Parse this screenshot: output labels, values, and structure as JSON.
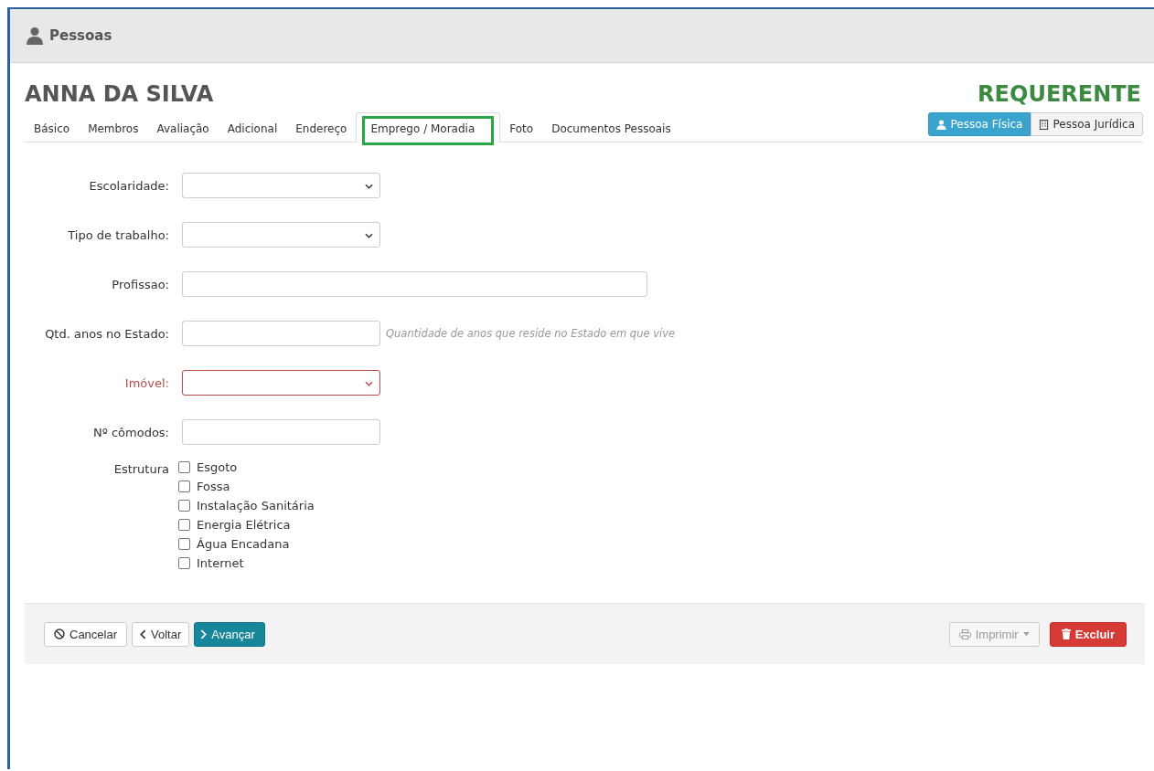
{
  "header": {
    "title": "Pessoas"
  },
  "person": {
    "name": "ANNA DA SILVA",
    "role": "REQUERENTE"
  },
  "tabs": [
    {
      "label": "Básico",
      "selected": false,
      "highlighted": false
    },
    {
      "label": "Membros",
      "selected": false,
      "highlighted": false
    },
    {
      "label": "Avaliação",
      "selected": false,
      "highlighted": false
    },
    {
      "label": "Adicional",
      "selected": false,
      "highlighted": false
    },
    {
      "label": "Endereço",
      "selected": false,
      "highlighted": false
    },
    {
      "label": "Emprego / Moradia",
      "selected": true,
      "highlighted": true
    },
    {
      "label": "Foto",
      "selected": false,
      "highlighted": false
    },
    {
      "label": "Documentos Pessoais",
      "selected": false,
      "highlighted": false
    }
  ],
  "person_type": [
    {
      "label": "Pessoa Física",
      "kind": "person",
      "selected": true
    },
    {
      "label": "Pessoa Jurídica",
      "kind": "building",
      "selected": false
    }
  ],
  "fields": [
    {
      "label": "Escolaridade:",
      "kind": "select",
      "wide": false,
      "invalid": false
    },
    {
      "label": "Tipo de trabalho:",
      "kind": "select",
      "wide": false,
      "invalid": false
    },
    {
      "label": "Profissao:",
      "kind": "text",
      "wide": true,
      "invalid": false
    },
    {
      "label": "Qtd. anos no Estado:",
      "kind": "text",
      "wide": false,
      "invalid": false,
      "hint": "Quantidade de anos que reside no Estado em que vive"
    },
    {
      "label": "Imóvel:",
      "kind": "select",
      "wide": false,
      "invalid": true
    },
    {
      "label": "Nº cômodos:",
      "kind": "text",
      "wide": false,
      "invalid": false
    }
  ],
  "estrutura": {
    "label": "Estrutura",
    "options": [
      {
        "label": "Esgoto",
        "checked": false
      },
      {
        "label": "Fossa",
        "checked": false
      },
      {
        "label": "Instalação Sanitária",
        "checked": false
      },
      {
        "label": "Energia Elétrica",
        "checked": false
      },
      {
        "label": "Água Encadana",
        "checked": false
      },
      {
        "label": "Internet",
        "checked": false
      }
    ]
  },
  "footer": {
    "left": [
      {
        "label": "Cancelar",
        "kind": "cancel",
        "disabled": false
      },
      {
        "label": "Voltar",
        "kind": "back",
        "disabled": false
      },
      {
        "label": "Avançar",
        "kind": "next",
        "disabled": false
      }
    ],
    "right": [
      {
        "label": "Imprimir",
        "kind": "print",
        "disabled": true
      },
      {
        "label": "Excluir",
        "kind": "delete",
        "disabled": false
      }
    ]
  }
}
